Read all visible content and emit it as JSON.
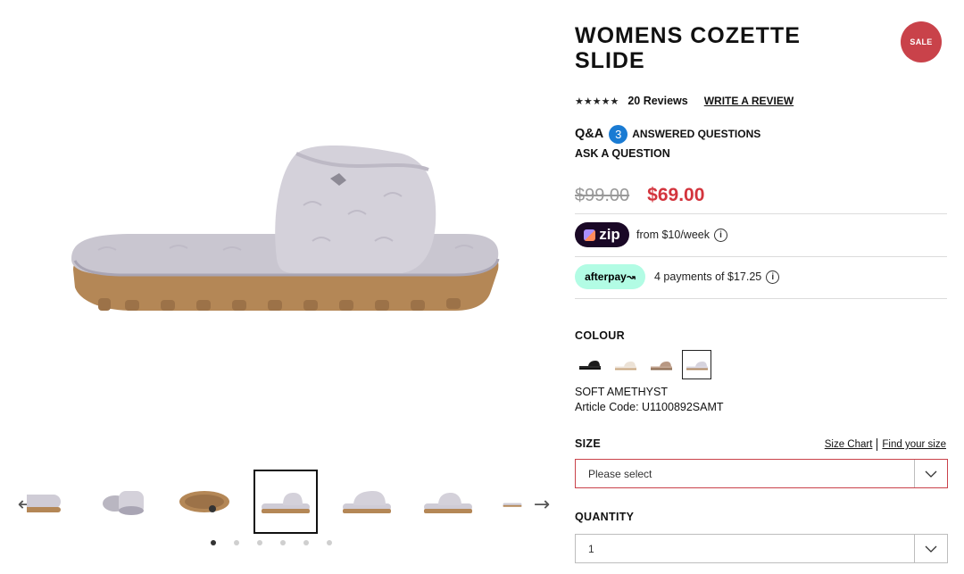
{
  "product": {
    "title": "WOMENS COZETTE SLIDE",
    "sale_badge": "SALE",
    "rating_stars": "★★★★★",
    "reviews_label": "20 Reviews",
    "write_review_label": "WRITE A REVIEW",
    "qa_label": "Q&A",
    "qa_count": "3",
    "qa_answered_label": "ANSWERED QUESTIONS",
    "ask_question_label": "ASK A QUESTION",
    "rating_value": 4.5
  },
  "price": {
    "original": "$99.00",
    "sale": "$69.00",
    "sale_color": "#d3343d"
  },
  "payments": {
    "zip_logo": "zip",
    "zip_text": "from $10/week",
    "afterpay_logo": "afterpay↝",
    "afterpay_text": "4 payments of $17.25",
    "info_icon": "i"
  },
  "colour": {
    "label": "COLOUR",
    "selected_name": "SOFT AMETHYST",
    "article_code": "Article Code: U1100892SAMT",
    "swatches": [
      {
        "name": "black",
        "color": "#1b1b1b",
        "sole": "#111"
      },
      {
        "name": "sand",
        "color": "#ece2d6",
        "sole": "#c9a77f"
      },
      {
        "name": "chestnut",
        "color": "#b89883",
        "sole": "#8b6a4f"
      },
      {
        "name": "soft-amethyst",
        "color": "#d6d3dd",
        "sole": "#b08962",
        "selected": true
      }
    ]
  },
  "size": {
    "label": "SIZE",
    "size_chart_link": "Size Chart",
    "find_size_link": "Find your size",
    "select_value": "Please select"
  },
  "quantity": {
    "label": "QUANTITY",
    "value": "1"
  },
  "gallery": {
    "prev_icon": "←",
    "next_icon": "→",
    "thumb_count": 7,
    "selected_thumb": 3,
    "dot_count": 6,
    "active_dot": 0
  },
  "colors": {
    "sale_badge": "#c9424a",
    "qa_badge": "#1a7bd3",
    "zip_bg": "#1a0826",
    "afterpay_bg": "#b2fce4"
  }
}
